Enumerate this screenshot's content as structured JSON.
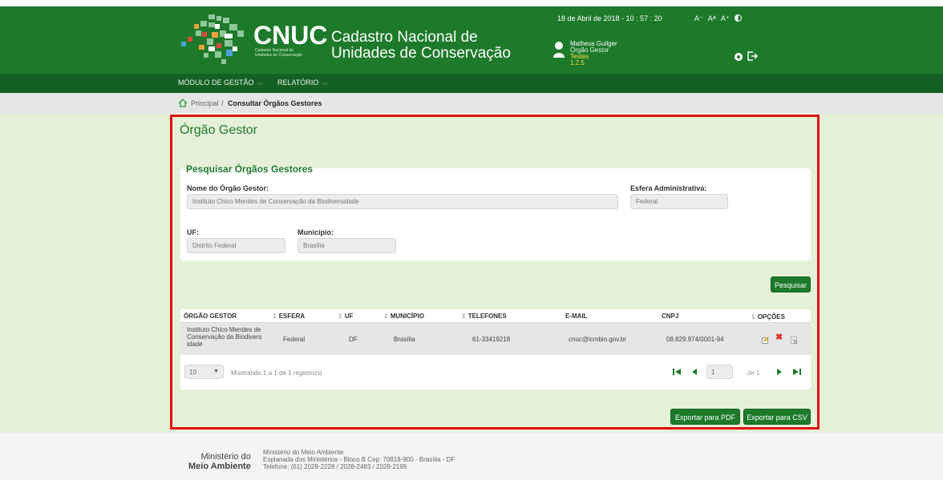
{
  "header": {
    "logo_word": "CNUC",
    "logo_sub": [
      "Cadastro Nacional de",
      "Unidades de Conservação"
    ],
    "app_title": [
      "Cadastro Nacional de",
      "Unidades de Conservação"
    ],
    "datetime": "18 de Abril de 2018 - 10 : 57 : 20",
    "font_controls": [
      "A⁻",
      "Aᴬ",
      "A⁺"
    ],
    "user": {
      "name": "Matheus Guilger",
      "role": "Órgão Gestor",
      "env": "Testes",
      "version": "1.2.5"
    }
  },
  "menu": {
    "items": [
      {
        "label": "MÓDULO DE GESTÃO"
      },
      {
        "label": "RELATÓRIO"
      }
    ]
  },
  "breadcrumb": {
    "home": "Principal",
    "separator": "/",
    "current": "Consultar Órgãos Gestores"
  },
  "page": {
    "title": "Órgão Gestor",
    "section_title": "Pesquisar Órgãos Gestores",
    "form": {
      "nome_label": "Nome do Órgão Gestor:",
      "nome_value": "Instituto Chico Mendes de Conservação da Biodiversidade",
      "esfera_label": "Esfera Administrativa:",
      "esfera_value": "Federal",
      "uf_label": "UF:",
      "uf_value": "Distrito Federal",
      "municipio_label": "Município:",
      "municipio_value": "Brasília"
    },
    "search_button": "Pesquisar",
    "table": {
      "columns": [
        "ÓRGÃO GESTOR",
        "ESFERA",
        "UF",
        "MUNICÍPIO",
        "TELEFONES",
        "E-MAIL",
        "CNPJ",
        "OPÇÕES"
      ],
      "rows": [
        {
          "orgao": [
            "Instituto Chico Mendes de",
            "Conservação da Biodivers",
            "idade"
          ],
          "esfera": "Federal",
          "uf": "DF",
          "municipio": "Brasília",
          "telefones": "61-33419218",
          "email": "cnuc@icmbio.gov.br",
          "cnpj": "08.829.974/0001-94"
        }
      ]
    },
    "pager": {
      "page_size": "10",
      "info": "Mostrando 1 a 1 de 1 registro(s)",
      "current_page": "1",
      "of": "de 1"
    },
    "export_pdf": "Exportar para PDF",
    "export_csv": "Exportar para CSV"
  },
  "footer": {
    "logo": [
      "Ministério do",
      "Meio Ambiente"
    ],
    "lines": [
      "Ministério do Meio Ambiente",
      "Esplanada dos Ministérios - Bloco B Cep: 70818-900 - Brasília - DF",
      "Telefone: (61) 2028-2228 / 2028-2483 / 2028-2199"
    ]
  },
  "colors": {
    "primary_green": "#1d7a2a",
    "dark_green": "#156124",
    "highlight_border": "#e01010",
    "background": "#e4f0d8"
  }
}
